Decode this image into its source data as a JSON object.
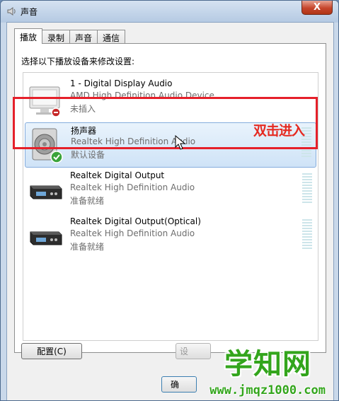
{
  "window": {
    "title": "声音",
    "close_glyph": "X"
  },
  "tabs": [
    {
      "label": "播放",
      "active": true
    },
    {
      "label": "录制",
      "active": false
    },
    {
      "label": "声音",
      "active": false
    },
    {
      "label": "通信",
      "active": false
    }
  ],
  "panel": {
    "instruction": "选择以下播放设备来修改设置:"
  },
  "devices": [
    {
      "name": "1 - Digital Display Audio",
      "driver": "AMD High Definition Audio Device",
      "status": "未插入",
      "icon": "monitor-icon",
      "badge": "unplugged-badge-icon"
    },
    {
      "name": "扬声器",
      "driver": "Realtek High Definition Audio",
      "status": "默认设备",
      "icon": "speaker-icon",
      "badge": "default-checkmark-icon",
      "selected": true
    },
    {
      "name": "Realtek Digital Output",
      "driver": "Realtek High Definition Audio",
      "status": "准备就绪",
      "icon": "digital-output-device-icon"
    },
    {
      "name": "Realtek Digital Output(Optical)",
      "driver": "Realtek High Definition Audio",
      "status": "准备就绪",
      "icon": "digital-output-device-icon"
    }
  ],
  "annotation": {
    "text": "双击进入",
    "color": "#e5202a"
  },
  "buttons": {
    "configure": "配置(C)",
    "set_default_partial": "设",
    "ok_partial": "确"
  },
  "watermark": {
    "title": "学知网",
    "url": "www.jmqz1000.com",
    "color": "#33a51c"
  }
}
